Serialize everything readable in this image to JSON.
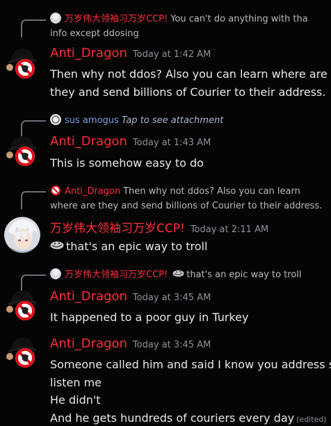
{
  "messages": [
    {
      "reply": {
        "author": "万岁伟大领袖习万岁CCP!",
        "text_line1": "You can't do anything with tha",
        "text_line2": "info except ddosing"
      },
      "author": "Anti_Dragon",
      "timestamp": "Today at 1:42 AM",
      "lines": [
        "Then why not ddos? Also you can learn where are",
        "they and send billions of Courier to their address."
      ]
    },
    {
      "reply": {
        "author": "sus amogus",
        "text": "Tap to see attachment"
      },
      "author": "Anti_Dragon",
      "timestamp": "Today at 1:43 AM",
      "lines": [
        "This is somehow easy to do"
      ]
    },
    {
      "reply": {
        "author": "Anti_Dragon",
        "text_line1": "Then why not ddos? Also you can learn",
        "text_line2": "where are they and send billions of Courier to their address."
      },
      "author": "万岁伟大领袖习万岁CCP!",
      "timestamp": "Today at 2:11 AM",
      "lines": [
        "that's an epic way to troll"
      ]
    },
    {
      "reply": {
        "author": "万岁伟大领袖习万岁CCP!",
        "text": "that's an epic way to troll"
      },
      "author": "Anti_Dragon",
      "timestamp": "Today at 3:45 AM",
      "lines": [
        "It happened to a poor guy in Turkey"
      ]
    },
    {
      "author": "Anti_Dragon",
      "timestamp": "Today at 3:45 AM",
      "lines": [
        "Someone called him and said I know you address so",
        "listen me",
        "He didn't",
        "And he gets hundreds of couriers every day"
      ],
      "edited": "(edited)"
    }
  ],
  "colors": {
    "background": "#050505",
    "username_red": "#ff2d3c",
    "username_blue": "#7aa3e8",
    "timestamp": "#8e9297",
    "message_text": "#e8e8e8"
  }
}
